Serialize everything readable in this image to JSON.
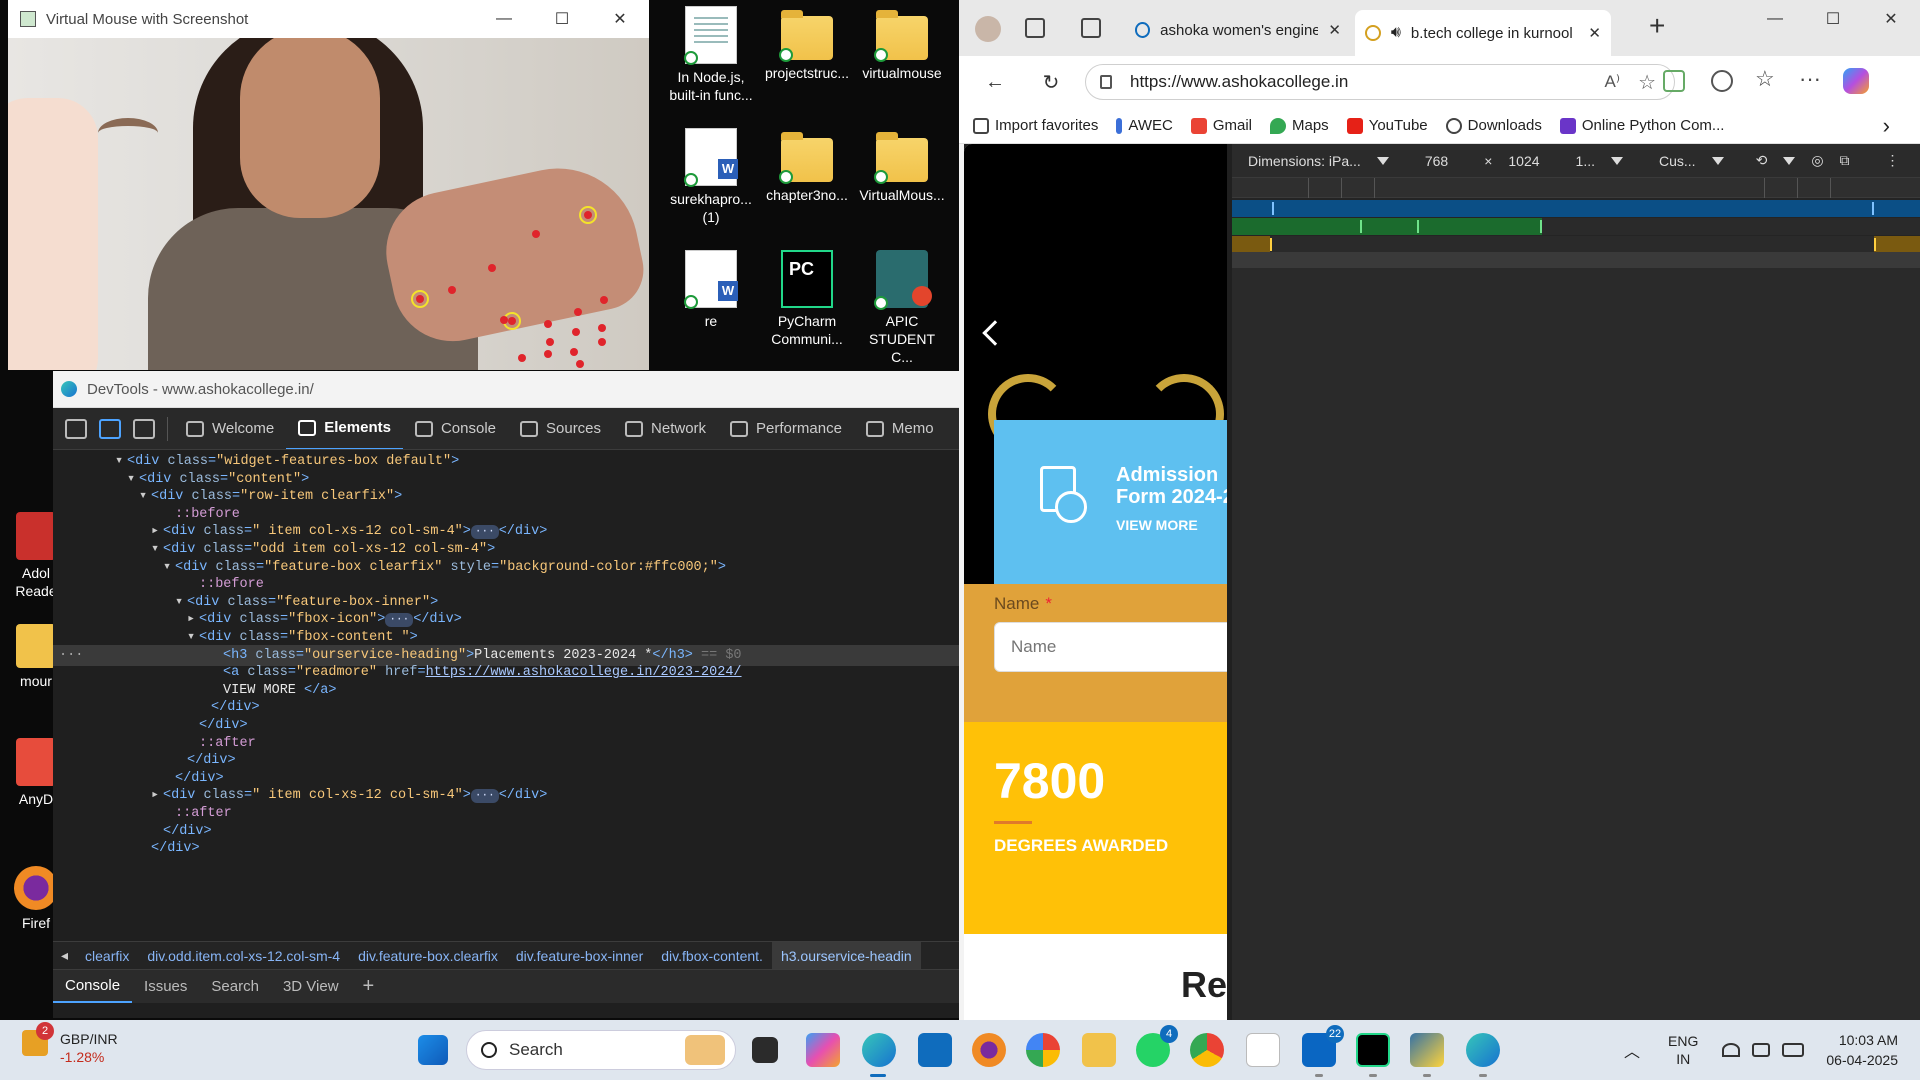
{
  "virtual_mouse": {
    "title": "Virtual Mouse with Screenshot"
  },
  "desktop_icons": [
    {
      "label": "In Node.js, built-in func...",
      "icon": "word-doc-icon"
    },
    {
      "label": "projectstruc...",
      "icon": "folder-icon"
    },
    {
      "label": "virtualmouse",
      "icon": "folder-icon"
    },
    {
      "label": "surekhapro... (1)",
      "icon": "word-doc-icon"
    },
    {
      "label": "chapter3no...",
      "icon": "folder-icon"
    },
    {
      "label": "VirtualMous...",
      "icon": "folder-icon"
    },
    {
      "label": "re",
      "icon": "word-doc-icon"
    },
    {
      "label": "PyCharm Communi...",
      "icon": "pycharm-icon"
    },
    {
      "label": "APIC STUDENT C...",
      "icon": "apic-icon"
    }
  ],
  "desktop_side_icons": [
    {
      "label": "Adol Reade",
      "icon": "adobe-reader-icon"
    },
    {
      "label": "mour",
      "icon": "folder-icon"
    },
    {
      "label": "AnyD",
      "icon": "anydesk-icon"
    },
    {
      "label": "Firef",
      "icon": "firefox-icon"
    }
  ],
  "devtools": {
    "title": "DevTools - www.ashokacollege.in/",
    "tabs": [
      "Welcome",
      "Elements",
      "Console",
      "Sources",
      "Network",
      "Performance",
      "Memo"
    ],
    "active_tab": "Elements",
    "tree": [
      {
        "indent": 16,
        "tri": "▾",
        "html": [
          [
            "tag",
            "<div "
          ],
          [
            "attr",
            "class"
          ],
          [
            "tag",
            "="
          ],
          [
            "aval",
            "\"widget-features-box  default\""
          ],
          [
            "tag",
            ">"
          ]
        ]
      },
      {
        "indent": 17,
        "tri": "▾",
        "html": [
          [
            "tag",
            "<div "
          ],
          [
            "attr",
            "class"
          ],
          [
            "tag",
            "="
          ],
          [
            "aval",
            "\"content\""
          ],
          [
            "tag",
            ">"
          ]
        ]
      },
      {
        "indent": 18,
        "tri": "▾",
        "html": [
          [
            "tag",
            "<div "
          ],
          [
            "attr",
            "class"
          ],
          [
            "tag",
            "="
          ],
          [
            "aval",
            "\"row-item clearfix\""
          ],
          [
            "tag",
            ">"
          ]
        ]
      },
      {
        "indent": 20,
        "tri": "",
        "html": [
          [
            "pseudo",
            "::before"
          ]
        ]
      },
      {
        "indent": 19,
        "tri": "▸",
        "html": [
          [
            "tag",
            "<div "
          ],
          [
            "attr",
            "class"
          ],
          [
            "tag",
            "="
          ],
          [
            "aval",
            "\" item col-xs-12 col-sm-4\""
          ],
          [
            "tag",
            ">"
          ],
          [
            "ell",
            "···"
          ],
          [
            "tag",
            "</div>"
          ]
        ]
      },
      {
        "indent": 19,
        "tri": "▾",
        "html": [
          [
            "tag",
            "<div "
          ],
          [
            "attr",
            "class"
          ],
          [
            "tag",
            "="
          ],
          [
            "aval",
            "\"odd item col-xs-12 col-sm-4\""
          ],
          [
            "tag",
            ">"
          ]
        ]
      },
      {
        "indent": 20,
        "tri": "▾",
        "html": [
          [
            "tag",
            "<div "
          ],
          [
            "attr",
            "class"
          ],
          [
            "tag",
            "="
          ],
          [
            "aval",
            "\"feature-box clearfix\""
          ],
          [
            "tag",
            " "
          ],
          [
            "attr",
            "style"
          ],
          [
            "tag",
            "="
          ],
          [
            "aval",
            "\"background-color:#ffc000;\""
          ],
          [
            "tag",
            ">"
          ]
        ]
      },
      {
        "indent": 22,
        "tri": "",
        "html": [
          [
            "pseudo",
            "::before"
          ]
        ]
      },
      {
        "indent": 21,
        "tri": "▾",
        "html": [
          [
            "tag",
            "<div "
          ],
          [
            "attr",
            "class"
          ],
          [
            "tag",
            "="
          ],
          [
            "aval",
            "\"feature-box-inner\""
          ],
          [
            "tag",
            ">"
          ]
        ]
      },
      {
        "indent": 22,
        "tri": "▸",
        "html": [
          [
            "tag",
            "<div "
          ],
          [
            "attr",
            "class"
          ],
          [
            "tag",
            "="
          ],
          [
            "aval",
            "\"fbox-icon\""
          ],
          [
            "tag",
            ">"
          ],
          [
            "ell",
            "···"
          ],
          [
            "tag",
            "</div>"
          ]
        ]
      },
      {
        "indent": 22,
        "tri": "▾",
        "html": [
          [
            "tag",
            "<div "
          ],
          [
            "attr",
            "class"
          ],
          [
            "tag",
            "="
          ],
          [
            "aval",
            "\"fbox-content \""
          ],
          [
            "tag",
            ">"
          ]
        ]
      },
      {
        "indent": 24,
        "tri": "",
        "sel": true,
        "html": [
          [
            "tag",
            "<h3 "
          ],
          [
            "attr",
            "class"
          ],
          [
            "tag",
            "="
          ],
          [
            "aval",
            "\"ourservice-heading\""
          ],
          [
            "tag",
            ">"
          ],
          [
            "txt",
            "Placements 2023-2024 *"
          ],
          [
            "tag",
            "</h3>"
          ],
          [
            "dim",
            " == $0"
          ]
        ]
      },
      {
        "indent": 24,
        "tri": "",
        "html": [
          [
            "tag",
            "<a "
          ],
          [
            "attr",
            "class"
          ],
          [
            "tag",
            "="
          ],
          [
            "aval",
            "\"readmore\""
          ],
          [
            "tag",
            " "
          ],
          [
            "attr",
            "href"
          ],
          [
            "tag",
            "="
          ],
          [
            "lnk",
            "https://www.ashokacollege.in/2023-2024/"
          ]
        ]
      },
      {
        "indent": 24,
        "tri": "",
        "html": [
          [
            "txt",
            "VIEW MORE "
          ],
          [
            "tag",
            "</a>"
          ]
        ]
      },
      {
        "indent": 23,
        "tri": "",
        "html": [
          [
            "tag",
            "</div>"
          ]
        ]
      },
      {
        "indent": 22,
        "tri": "",
        "html": [
          [
            "tag",
            "</div>"
          ]
        ]
      },
      {
        "indent": 22,
        "tri": "",
        "html": [
          [
            "pseudo",
            "::after"
          ]
        ]
      },
      {
        "indent": 21,
        "tri": "",
        "html": [
          [
            "tag",
            "</div>"
          ]
        ]
      },
      {
        "indent": 20,
        "tri": "",
        "html": [
          [
            "tag",
            "</div>"
          ]
        ]
      },
      {
        "indent": 19,
        "tri": "▸",
        "html": [
          [
            "tag",
            "<div "
          ],
          [
            "attr",
            "class"
          ],
          [
            "tag",
            "="
          ],
          [
            "aval",
            "\" item col-xs-12 col-sm-4\""
          ],
          [
            "tag",
            ">"
          ],
          [
            "ell",
            "···"
          ],
          [
            "tag",
            "</div>"
          ]
        ]
      },
      {
        "indent": 20,
        "tri": "",
        "html": [
          [
            "pseudo",
            "::after"
          ]
        ]
      },
      {
        "indent": 19,
        "tri": "",
        "html": [
          [
            "tag",
            "</div>"
          ]
        ]
      },
      {
        "indent": 18,
        "tri": "",
        "html": [
          [
            "tag",
            "</div>"
          ]
        ]
      }
    ],
    "breadcrumb": [
      "clearfix",
      "div.odd.item.col-xs-12.col-sm-4",
      "div.feature-box.clearfix",
      "div.feature-box-inner",
      "div.fbox-content.",
      "h3.ourservice-headin"
    ],
    "drawer_tabs": [
      "Console",
      "Issues",
      "Search",
      "3D View"
    ],
    "drawer_add": "+"
  },
  "browser": {
    "tabs": [
      {
        "label": "ashoka women's engineering",
        "icon": "search-icon",
        "active": false
      },
      {
        "label": "b.tech college in kurnool",
        "icon": "audio-icon",
        "active": true
      }
    ],
    "new_tab": "+",
    "url": "https://www.ashokacollege.in",
    "favorites": [
      "Import favorites",
      "AWEC",
      "Gmail",
      "Maps",
      "YouTube",
      "Downloads",
      "Online Python Com..."
    ],
    "favorites_more": "›"
  },
  "site": {
    "admission_title": "Admission Form 2024-2",
    "admission_link": "VIEW MORE",
    "name_label": "Name",
    "name_required": "*",
    "name_placeholder": "Name",
    "stat_number": "7800",
    "stat_label": "DEGREES AWARDED",
    "bottom_text": "Re"
  },
  "emulation": {
    "device": "Dimensions: iPa...",
    "width": "768",
    "times": "×",
    "height": "1024",
    "zoom": "1...",
    "throttle": "Cus..."
  },
  "taskbar": {
    "weather_title": "GBP/INR",
    "weather_value": "-1.28%",
    "weather_badge": "2",
    "search_placeholder": "Search",
    "badges": {
      "whatsapp": "4",
      "linkedin": "22"
    },
    "lang_1": "ENG",
    "lang_2": "IN",
    "time": "10:03 AM",
    "date": "06-04-2025"
  },
  "colors": {
    "devtools_bg": "#1f1f1f",
    "accent_blue": "#4da3ff",
    "admission_blue": "#5ec0f0",
    "form_orange": "#e0a23a",
    "stats_yellow": "#ffc107"
  }
}
